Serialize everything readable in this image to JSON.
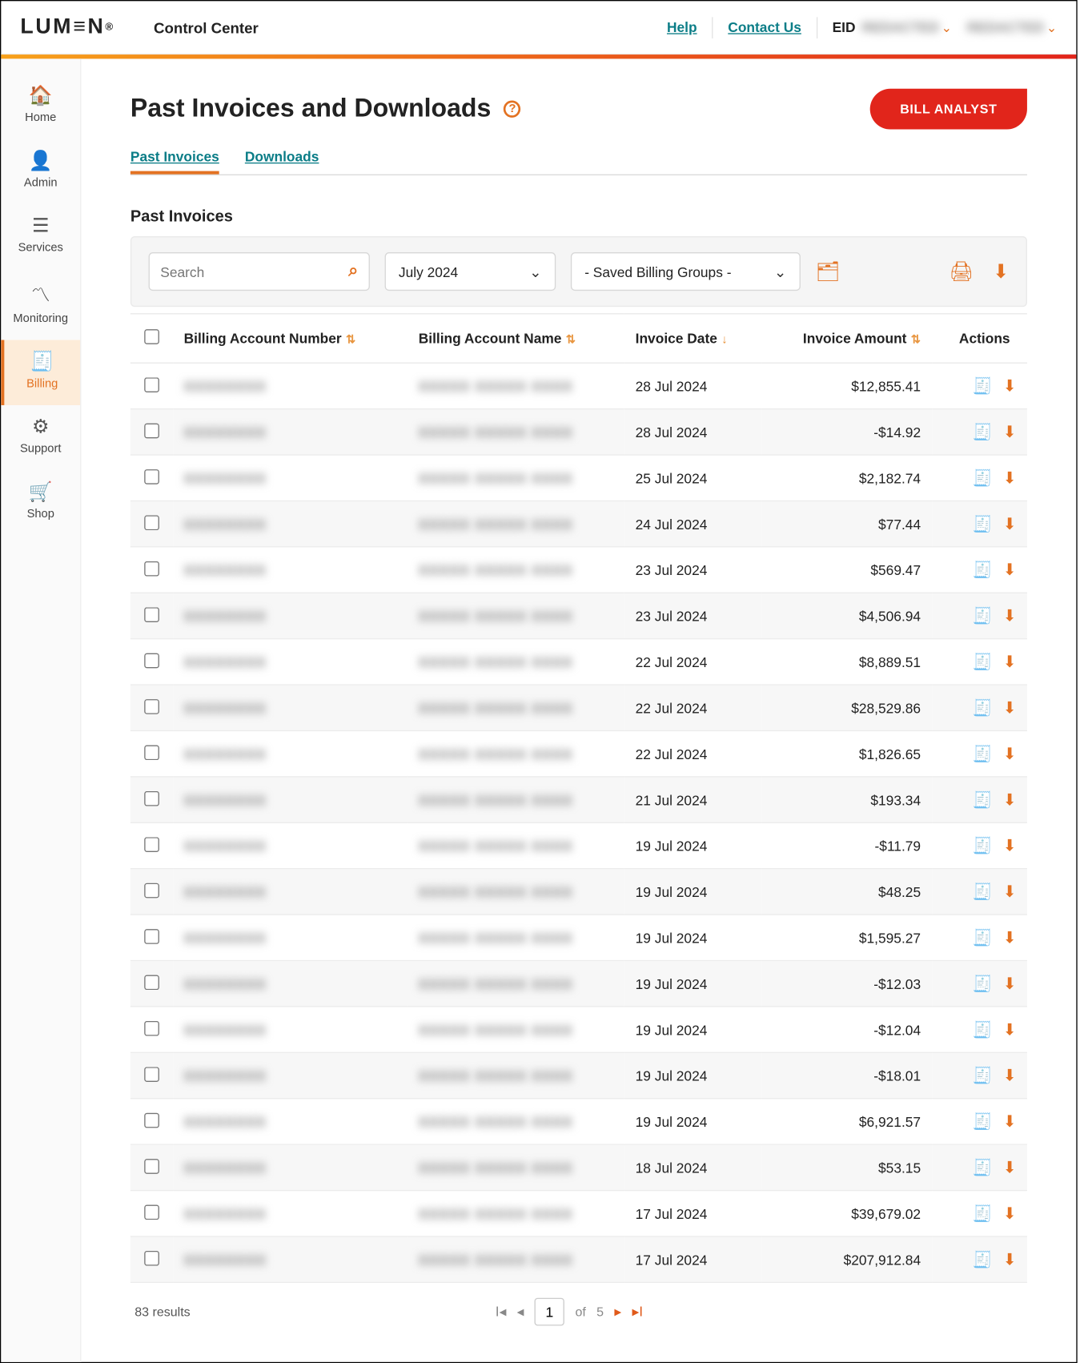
{
  "header": {
    "logo_text": "LUM≡N",
    "app_name": "Control Center",
    "help": "Help",
    "contact": "Contact Us",
    "eid_label": "EID",
    "eid_value": "REDACTED",
    "user_name": "REDACTED"
  },
  "sidebar": {
    "items": [
      {
        "label": "Home",
        "icon": "🏠"
      },
      {
        "label": "Admin",
        "icon": "👤"
      },
      {
        "label": "Services",
        "icon": "☰"
      },
      {
        "label": "Monitoring",
        "icon": "〽"
      },
      {
        "label": "Billing",
        "icon": "🧾",
        "active": true
      },
      {
        "label": "Support",
        "icon": "⚙"
      },
      {
        "label": "Shop",
        "icon": "🛒"
      }
    ]
  },
  "page": {
    "title": "Past Invoices and Downloads",
    "bill_analyst": "BILL ANALYST",
    "tabs": [
      {
        "label": "Past Invoices",
        "active": true
      },
      {
        "label": "Downloads",
        "active": false
      }
    ],
    "section_title": "Past Invoices"
  },
  "filters": {
    "search_placeholder": "Search",
    "month": "July 2024",
    "billing_group": "- Saved Billing Groups -"
  },
  "table": {
    "columns": {
      "account_number": "Billing Account Number",
      "account_name": "Billing Account Name",
      "invoice_date": "Invoice Date",
      "invoice_amount": "Invoice Amount",
      "actions": "Actions"
    },
    "rows": [
      {
        "date": "28 Jul 2024",
        "amount": "$12,855.41",
        "doc": "solid"
      },
      {
        "date": "28 Jul 2024",
        "amount": "-$14.92",
        "doc": "solid"
      },
      {
        "date": "25 Jul 2024",
        "amount": "$2,182.74",
        "doc": "solid"
      },
      {
        "date": "24 Jul 2024",
        "amount": "$77.44",
        "doc": "solid"
      },
      {
        "date": "23 Jul 2024",
        "amount": "$569.47",
        "doc": "solid"
      },
      {
        "date": "23 Jul 2024",
        "amount": "$4,506.94",
        "doc": "solid"
      },
      {
        "date": "22 Jul 2024",
        "amount": "$8,889.51",
        "doc": "faded"
      },
      {
        "date": "22 Jul 2024",
        "amount": "$28,529.86",
        "doc": "faded"
      },
      {
        "date": "22 Jul 2024",
        "amount": "$1,826.65",
        "doc": "faded"
      },
      {
        "date": "21 Jul 2024",
        "amount": "$193.34",
        "doc": "solid"
      },
      {
        "date": "19 Jul 2024",
        "amount": "-$11.79",
        "doc": "faded"
      },
      {
        "date": "19 Jul 2024",
        "amount": "$48.25",
        "doc": "solid"
      },
      {
        "date": "19 Jul 2024",
        "amount": "$1,595.27",
        "doc": "solid"
      },
      {
        "date": "19 Jul 2024",
        "amount": "-$12.03",
        "doc": "faded"
      },
      {
        "date": "19 Jul 2024",
        "amount": "-$12.04",
        "doc": "faded"
      },
      {
        "date": "19 Jul 2024",
        "amount": "-$18.01",
        "doc": "faded"
      },
      {
        "date": "19 Jul 2024",
        "amount": "$6,921.57",
        "doc": "faded"
      },
      {
        "date": "18 Jul 2024",
        "amount": "$53.15",
        "doc": "solid"
      },
      {
        "date": "17 Jul 2024",
        "amount": "$39,679.02",
        "doc": "solid"
      },
      {
        "date": "17 Jul 2024",
        "amount": "$207,912.84",
        "doc": "solid"
      }
    ]
  },
  "pagination": {
    "results_text": "83 results",
    "current_page": "1",
    "of_label": "of",
    "total_pages": "5"
  }
}
